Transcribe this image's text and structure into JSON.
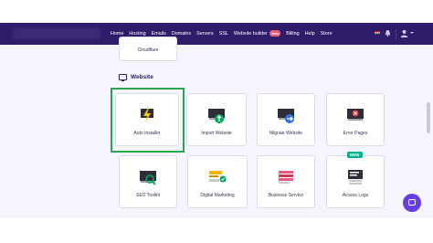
{
  "navbar": {
    "menu": [
      "Home",
      "Hosting",
      "Emails",
      "Domains",
      "Servers",
      "SSL",
      "Website builder",
      "Billing",
      "Help",
      "Store"
    ],
    "new_badge": "New"
  },
  "top_card": {
    "label": "Cloudflare"
  },
  "section": {
    "title": "Website"
  },
  "cards_row1": [
    {
      "label": "Auto Installer",
      "icon": "lightning-icon"
    },
    {
      "label": "Import Website",
      "icon": "import-icon"
    },
    {
      "label": "Migrate Website",
      "icon": "migrate-icon"
    },
    {
      "label": "Error Pages",
      "icon": "error-icon"
    }
  ],
  "cards_row2": [
    {
      "label": "SEO Toolkit",
      "icon": "seo-icon"
    },
    {
      "label": "Digital Marketing",
      "icon": "marketing-icon"
    },
    {
      "label": "Business Service",
      "icon": "business-icon"
    },
    {
      "label": "Access Logs",
      "icon": "logs-icon"
    }
  ],
  "access_logs_badge": "NEW",
  "colors": {
    "navbar": "#2f1c6a",
    "accent": "#673de6",
    "highlight": "#2aa44f",
    "new_badge": "#00b090"
  }
}
